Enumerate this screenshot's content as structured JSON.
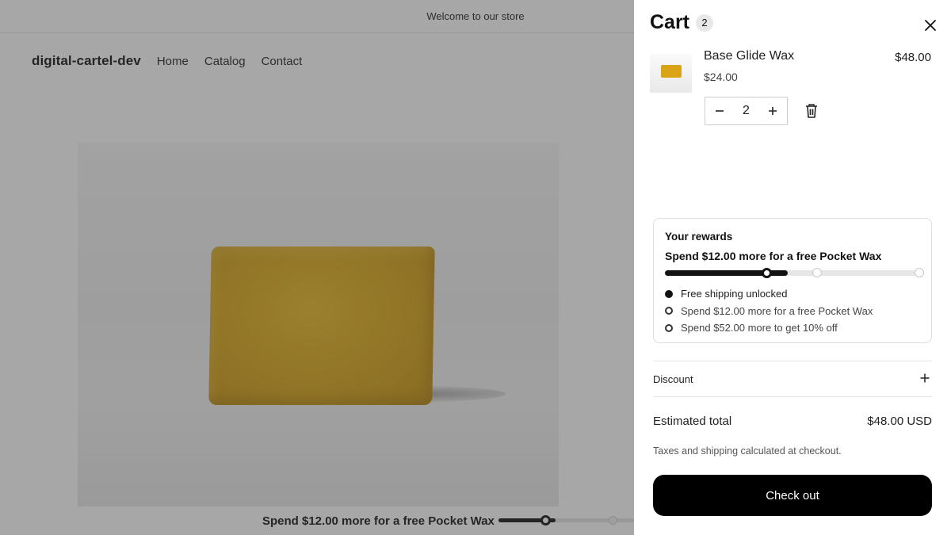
{
  "store": {
    "announcement": "Welcome to our store",
    "logo": "digital-cartel-dev",
    "nav": [
      {
        "label": "Home"
      },
      {
        "label": "Catalog"
      },
      {
        "label": "Contact"
      }
    ],
    "bottom_bar": {
      "text": "Spend $12.00 more for a free Pocket Wax"
    }
  },
  "cart": {
    "title": "Cart",
    "count": "2",
    "items": [
      {
        "title": "Base Glide Wax",
        "unit_price": "$24.00",
        "line_price": "$48.00",
        "quantity": "2"
      }
    ],
    "rewards": {
      "heading": "Your rewards",
      "headline": "Spend $12.00 more for a free Pocket Wax",
      "progress_fraction": 0.48,
      "milestones": [
        {
          "label": "Free shipping unlocked",
          "reached": true
        },
        {
          "label": "Spend $12.00 more for a free Pocket Wax",
          "reached": false
        },
        {
          "label": "Spend $52.00 more to get 10% off",
          "reached": false
        }
      ]
    },
    "discount_label": "Discount",
    "estimated_total_label": "Estimated total",
    "estimated_total_value": "$48.00 USD",
    "tax_note": "Taxes and shipping calculated at checkout.",
    "checkout_label": "Check out"
  },
  "icons": {
    "close": "close-icon",
    "minus": "minus-icon",
    "plus": "plus-icon",
    "trash": "trash-icon"
  },
  "colors": {
    "accent": "#121212",
    "checkout_bg": "#000000",
    "product": "#d9a516"
  }
}
